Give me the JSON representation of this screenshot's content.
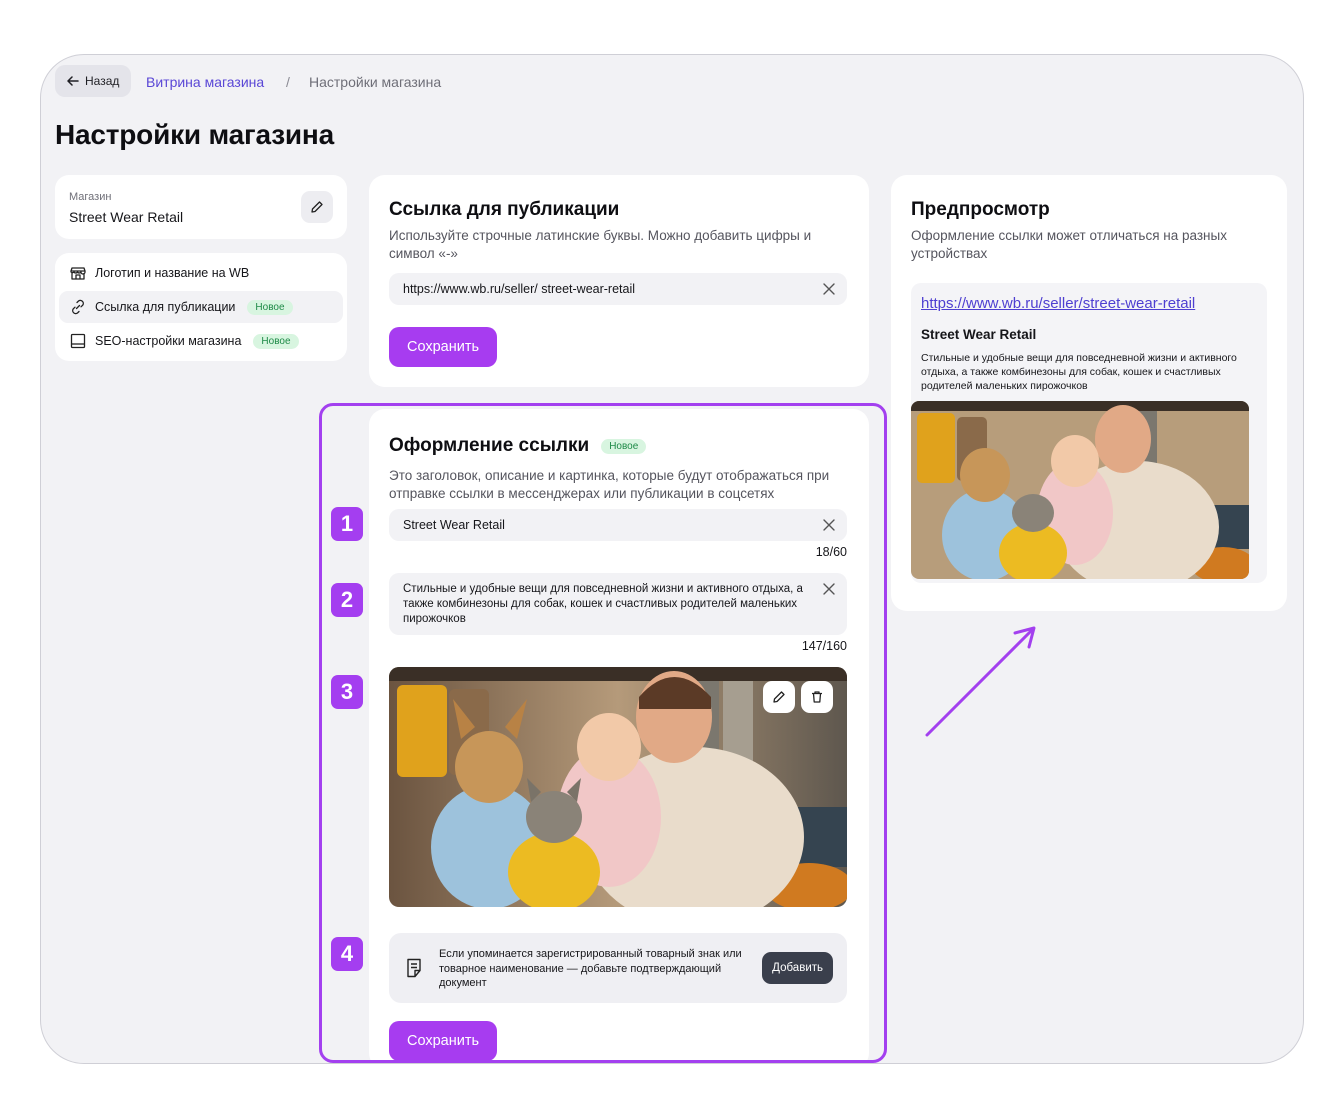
{
  "breadcrumb": {
    "back_label": "Назад",
    "parent_label": "Витрина магазина",
    "separator": "/",
    "current_label": "Настройки магазина"
  },
  "page": {
    "title": "Настройки магазина"
  },
  "store": {
    "label": "Магазин",
    "name": "Street Wear Retail"
  },
  "sidebar": {
    "items": [
      {
        "label": "Логотип и название на WB",
        "icon": "store-icon",
        "badge": ""
      },
      {
        "label": "Ссылка для публикации",
        "icon": "link-icon",
        "badge": "Новое"
      },
      {
        "label": "SEO-настройки магазина",
        "icon": "layout-icon",
        "badge": "Новое"
      }
    ]
  },
  "publication": {
    "title": "Ссылка для публикации",
    "description": "Используйте строчные латинские буквы. Можно добавить цифры и символ «-»",
    "url_value": "https://www.wb.ru/seller/ street-wear-retail",
    "save_label": "Сохранить"
  },
  "design": {
    "title": "Оформление ссылки",
    "badge": "Новое",
    "description": "Это заголовок, описание и картинка, которые будут отображаться при отправке ссылки в мессенджерах или публикации в соцсетях",
    "name_value": "Street Wear Retail",
    "name_counter": "18/60",
    "desc_value": "Стильные и удобные вещи для повседневной жизни и активного отдыха, а также комбинезоны для собак, кошек и счастливых родителей маленьких пирожочков",
    "desc_counter": "147/160",
    "doc_text": "Если упоминается зарегистрированный товарный знак или товарное наименование — добавьте подтверждающий документ",
    "doc_button": "Добавить",
    "save_label": "Сохранить"
  },
  "steps": [
    "1",
    "2",
    "3",
    "4"
  ],
  "preview": {
    "title": "Предпросмотр",
    "description": "Оформление ссылки может отличаться на разных устройствах",
    "url": "https://www.wb.ru/seller/street-wear-retail",
    "name": "Street Wear Retail",
    "desc": "Стильные и удобные вещи для повседневной жизни и активного отдыха, а также комбинезоны для собак, кошек и счастливых родителей маленьких пирожочков"
  },
  "colors": {
    "accent": "#a73cf0",
    "highlight": "#a340ef",
    "link": "#5a47d6",
    "badge_bg": "#d8f5e0",
    "badge_text": "#1e8a47"
  }
}
